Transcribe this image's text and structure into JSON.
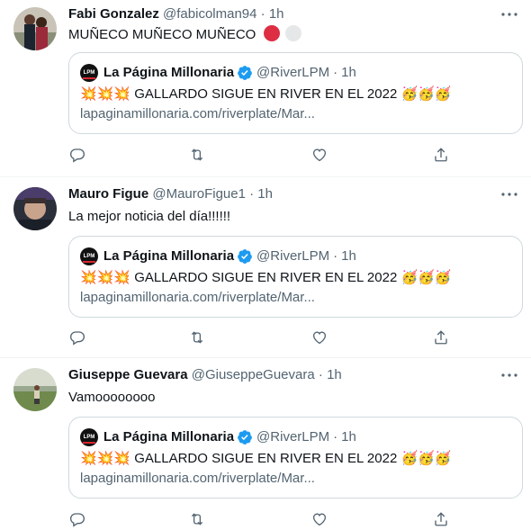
{
  "tweets": [
    {
      "name": "Fabi Gonzalez",
      "handle": "@fabicolman94",
      "dot": "·",
      "time": "1h",
      "text": "MUÑECO MUÑECO MUÑECO",
      "text_emojis": [
        "red-circle",
        "white-circle"
      ],
      "quote": {
        "avatar_text": "LPM",
        "name": "La Página Millonaria",
        "handle": "@RiverLPM",
        "dot": "·",
        "time": "1h",
        "text": "GALLARDO SIGUE EN RIVER EN EL 2022",
        "link": "lapaginamillonaria.com/riverplate/Mar..."
      }
    },
    {
      "name": "Mauro Figue",
      "handle": "@MauroFigue1",
      "dot": "·",
      "time": "1h",
      "text": "La mejor noticia del día!!!!!!",
      "quote": {
        "avatar_text": "LPM",
        "name": "La Página Millonaria",
        "handle": "@RiverLPM",
        "dot": "·",
        "time": "1h",
        "text": "GALLARDO SIGUE EN RIVER EN EL 2022",
        "link": "lapaginamillonaria.com/riverplate/Mar..."
      }
    },
    {
      "name": "Giuseppe Guevara",
      "handle": "@GiuseppeGuevara",
      "dot": "·",
      "time": "1h",
      "text": "Vamoooooooo",
      "quote": {
        "avatar_text": "LPM",
        "name": "La Página Millonaria",
        "handle": "@RiverLPM",
        "dot": "·",
        "time": "1h",
        "text": "GALLARDO SIGUE EN RIVER EN EL 2022",
        "link": "lapaginamillonaria.com/riverplate/Mar..."
      }
    }
  ],
  "icons": {
    "collision": "💥",
    "party_face": "🥳",
    "actions": [
      "reply-icon",
      "retweet-icon",
      "like-icon",
      "share-icon"
    ]
  },
  "colors": {
    "text": "#0f1419",
    "secondary": "#536471",
    "border": "#cfd9de",
    "verified": "#1d9bf0",
    "red_circle": "#dd2e44",
    "white_circle": "#e6e7e8"
  }
}
